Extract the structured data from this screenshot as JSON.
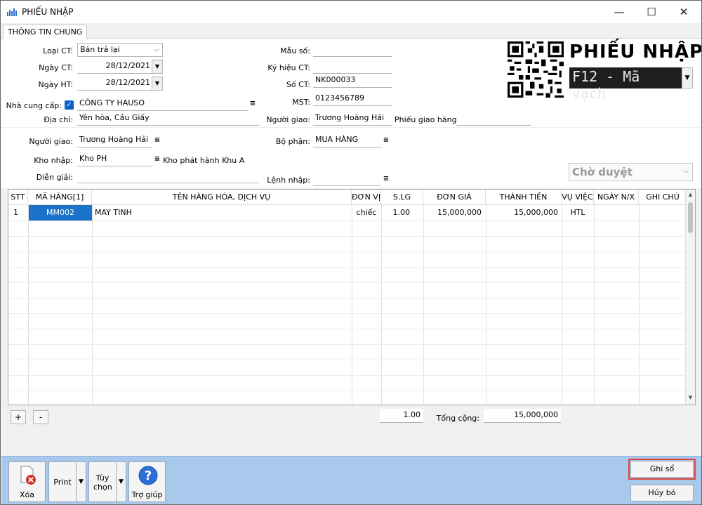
{
  "window": {
    "title": "PHIẾU NHẬP"
  },
  "tabs": [
    {
      "label": "THÔNG TIN CHUNG"
    }
  ],
  "form": {
    "loai_ct": {
      "label": "Loại CT:",
      "value": "Bán trả lại"
    },
    "ngay_ct": {
      "label": "Ngày CT:",
      "value": "28/12/2021"
    },
    "ngay_ht": {
      "label": "Ngày HT:",
      "value": "28/12/2021"
    },
    "nha_cung_cap": {
      "label": "Nhà cung cấp:",
      "value": "CÔNG TY HAUSO"
    },
    "dia_chi": {
      "label": "Địa chỉ:",
      "value": "Yên hòa, Cầu Giấy"
    },
    "mau_so": {
      "label": "Mẫu số:",
      "value": ""
    },
    "ky_hieu_ct": {
      "label": "Ký hiệu CT:",
      "value": ""
    },
    "so_ct": {
      "label": "Số CT:",
      "value": "NK000033"
    },
    "mst": {
      "label": "MST:",
      "value": "0123456789"
    },
    "nguoi_giao_top": {
      "label": "Người giao:",
      "value": "Trương Hoàng Hải"
    },
    "phieu_giao_hang": {
      "label": "Phiếu giao hàng:",
      "value": ""
    },
    "nguoi_giao": {
      "label": "Người giao:",
      "value": "Trương Hoàng Hải"
    },
    "kho_nhap": {
      "label": "Kho nhập:",
      "value": "Kho PH",
      "desc": "Kho phát hành Khu A"
    },
    "dien_giai": {
      "label": "Diễn giải:",
      "value": ""
    },
    "bo_phan": {
      "label": "Bộ phận:",
      "value": "MUA HÀNG"
    },
    "lenh_nhap": {
      "label": "Lệnh nhập:",
      "value": ""
    }
  },
  "header_right": {
    "big_title": "PHIẾU NHẬP",
    "barcode_mode": "F12 - Mã vạch",
    "status": "Chờ duyệt"
  },
  "grid": {
    "columns": [
      "STT",
      "MÃ HÀNG[1]",
      "TÊN HÀNG HÓA, DỊCH VỤ",
      "ĐƠN VỊ",
      "S.LG",
      "ĐƠN GIÁ",
      "THÀNH TIỀN",
      "VỤ VIỆC",
      "NGÀY N/X",
      "GHI CHÚ"
    ],
    "rows": [
      {
        "stt": "1",
        "ma_hang": "MM002",
        "ten_hang": "MAY TINH",
        "don_vi": "chiếc",
        "slg": "1.00",
        "don_gia": "15,000,000",
        "thanh_tien": "15,000,000",
        "vu_viec": "HTL",
        "ngay_nx": "",
        "ghi_chu": ""
      }
    ]
  },
  "grid_buttons": {
    "add": "+",
    "remove": "-"
  },
  "totals": {
    "qty": "1.00",
    "label": "Tổng cộng:",
    "amount": "15,000,000"
  },
  "toolbar": {
    "delete": "Xóa",
    "print": "Print",
    "options": "Tùy chọn",
    "help": "Trợ giúp"
  },
  "actions": {
    "save": "Ghi sổ",
    "cancel": "Hủy bỏ"
  },
  "colors": {
    "bottom_bar": "#a8c8ec",
    "selection": "#1a73c8",
    "highlight_outline": "#e0443e"
  }
}
